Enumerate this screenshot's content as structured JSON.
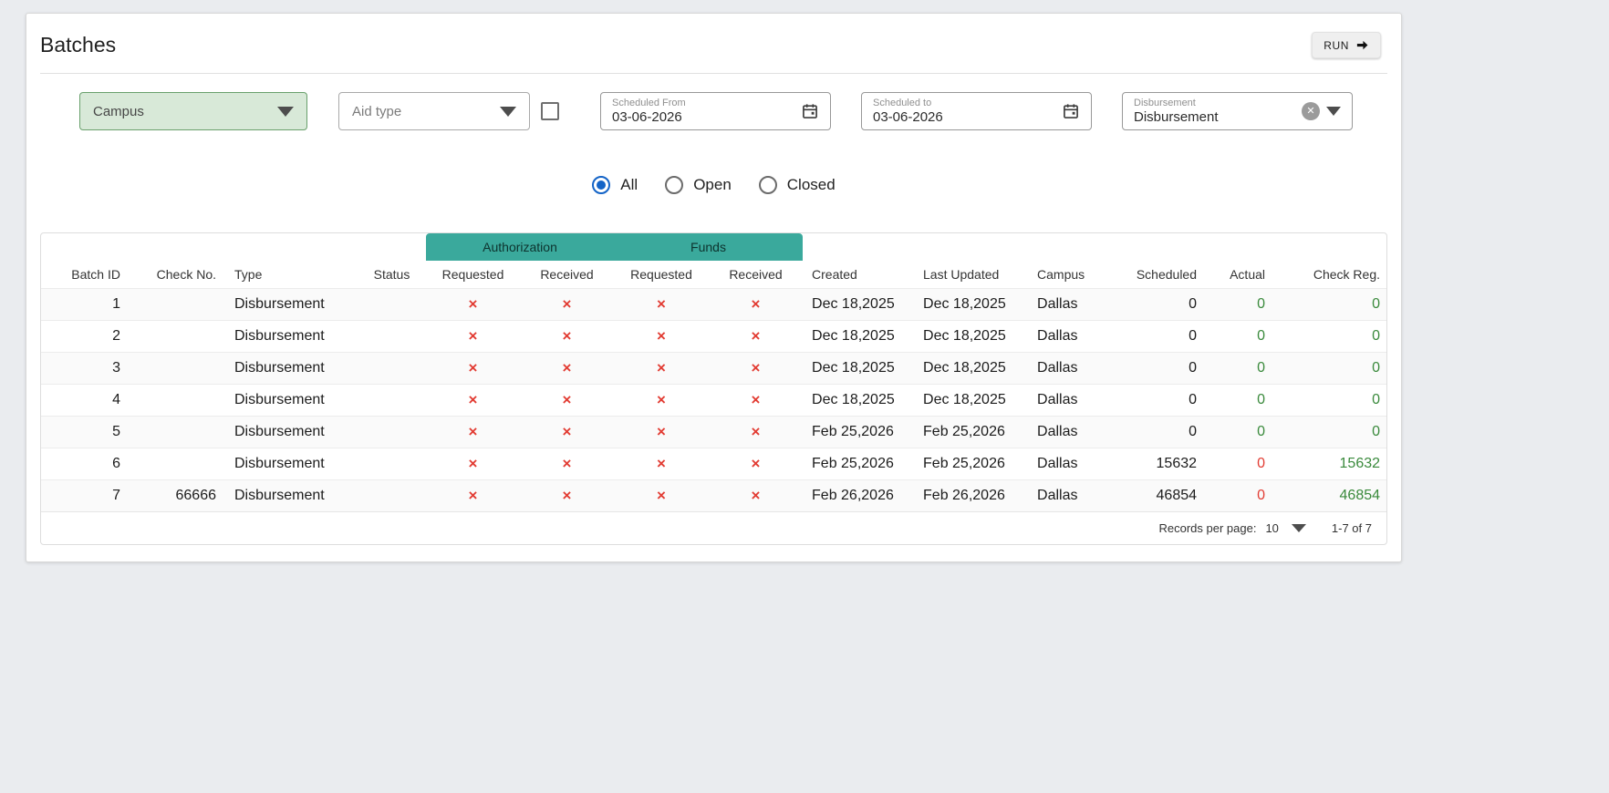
{
  "page": {
    "title": "Batches",
    "run_button": "RUN"
  },
  "filters": {
    "campus": {
      "label": "Campus"
    },
    "aid_type": {
      "label": "Aid type"
    },
    "scheduled_from": {
      "label": "Scheduled From",
      "value": "03-06-2026"
    },
    "scheduled_to": {
      "label": "Scheduled to",
      "value": "03-06-2026"
    },
    "disbursement": {
      "label": "Disbursement",
      "value": "Disbursement"
    }
  },
  "status_filter": {
    "options": [
      {
        "label": "All",
        "selected": true
      },
      {
        "label": "Open",
        "selected": false
      },
      {
        "label": "Closed",
        "selected": false
      }
    ]
  },
  "table": {
    "group_headers": [
      "Authorization",
      "Funds"
    ],
    "columns": [
      "Batch ID",
      "Check No.",
      "Type",
      "Status",
      "Requested",
      "Received",
      "Requested",
      "Received",
      "Created",
      "Last Updated",
      "Campus",
      "Scheduled",
      "Actual",
      "Check Reg."
    ],
    "rows": [
      {
        "batch_id": "1",
        "check_no": "",
        "type": "Disbursement",
        "status": "",
        "auth_requested": "×",
        "auth_received": "×",
        "funds_requested": "×",
        "funds_received": "×",
        "created": "Dec 18,2025",
        "last_updated": "Dec 18,2025",
        "campus": "Dallas",
        "scheduled": "0",
        "actual": "0",
        "actual_color": "green",
        "check_reg": "0",
        "check_reg_color": "green"
      },
      {
        "batch_id": "2",
        "check_no": "",
        "type": "Disbursement",
        "status": "",
        "auth_requested": "×",
        "auth_received": "×",
        "funds_requested": "×",
        "funds_received": "×",
        "created": "Dec 18,2025",
        "last_updated": "Dec 18,2025",
        "campus": "Dallas",
        "scheduled": "0",
        "actual": "0",
        "actual_color": "green",
        "check_reg": "0",
        "check_reg_color": "green"
      },
      {
        "batch_id": "3",
        "check_no": "",
        "type": "Disbursement",
        "status": "",
        "auth_requested": "×",
        "auth_received": "×",
        "funds_requested": "×",
        "funds_received": "×",
        "created": "Dec 18,2025",
        "last_updated": "Dec 18,2025",
        "campus": "Dallas",
        "scheduled": "0",
        "actual": "0",
        "actual_color": "green",
        "check_reg": "0",
        "check_reg_color": "green"
      },
      {
        "batch_id": "4",
        "check_no": "",
        "type": "Disbursement",
        "status": "",
        "auth_requested": "×",
        "auth_received": "×",
        "funds_requested": "×",
        "funds_received": "×",
        "created": "Dec 18,2025",
        "last_updated": "Dec 18,2025",
        "campus": "Dallas",
        "scheduled": "0",
        "actual": "0",
        "actual_color": "green",
        "check_reg": "0",
        "check_reg_color": "green"
      },
      {
        "batch_id": "5",
        "check_no": "",
        "type": "Disbursement",
        "status": "",
        "auth_requested": "×",
        "auth_received": "×",
        "funds_requested": "×",
        "funds_received": "×",
        "created": "Feb 25,2026",
        "last_updated": "Feb 25,2026",
        "campus": "Dallas",
        "scheduled": "0",
        "actual": "0",
        "actual_color": "green",
        "check_reg": "0",
        "check_reg_color": "green"
      },
      {
        "batch_id": "6",
        "check_no": "",
        "type": "Disbursement",
        "status": "",
        "auth_requested": "×",
        "auth_received": "×",
        "funds_requested": "×",
        "funds_received": "×",
        "created": "Feb 25,2026",
        "last_updated": "Feb 25,2026",
        "campus": "Dallas",
        "scheduled": "15632",
        "actual": "0",
        "actual_color": "red",
        "check_reg": "15632",
        "check_reg_color": "green"
      },
      {
        "batch_id": "7",
        "check_no": "66666",
        "type": "Disbursement",
        "status": "",
        "auth_requested": "×",
        "auth_received": "×",
        "funds_requested": "×",
        "funds_received": "×",
        "created": "Feb 26,2026",
        "last_updated": "Feb 26,2026",
        "campus": "Dallas",
        "scheduled": "46854",
        "actual": "0",
        "actual_color": "red",
        "check_reg": "46854",
        "check_reg_color": "green"
      }
    ]
  },
  "pagination": {
    "records_per_page_label": "Records per page:",
    "records_per_page": "10",
    "range_label": "1-7 of 7"
  },
  "colors": {
    "teal": "#3aa99c",
    "red": "#e23c33",
    "green": "#3a8a3c",
    "blue": "#1464c7",
    "campus-bg": "#d8e9d8",
    "campus-border": "#69a06c"
  }
}
